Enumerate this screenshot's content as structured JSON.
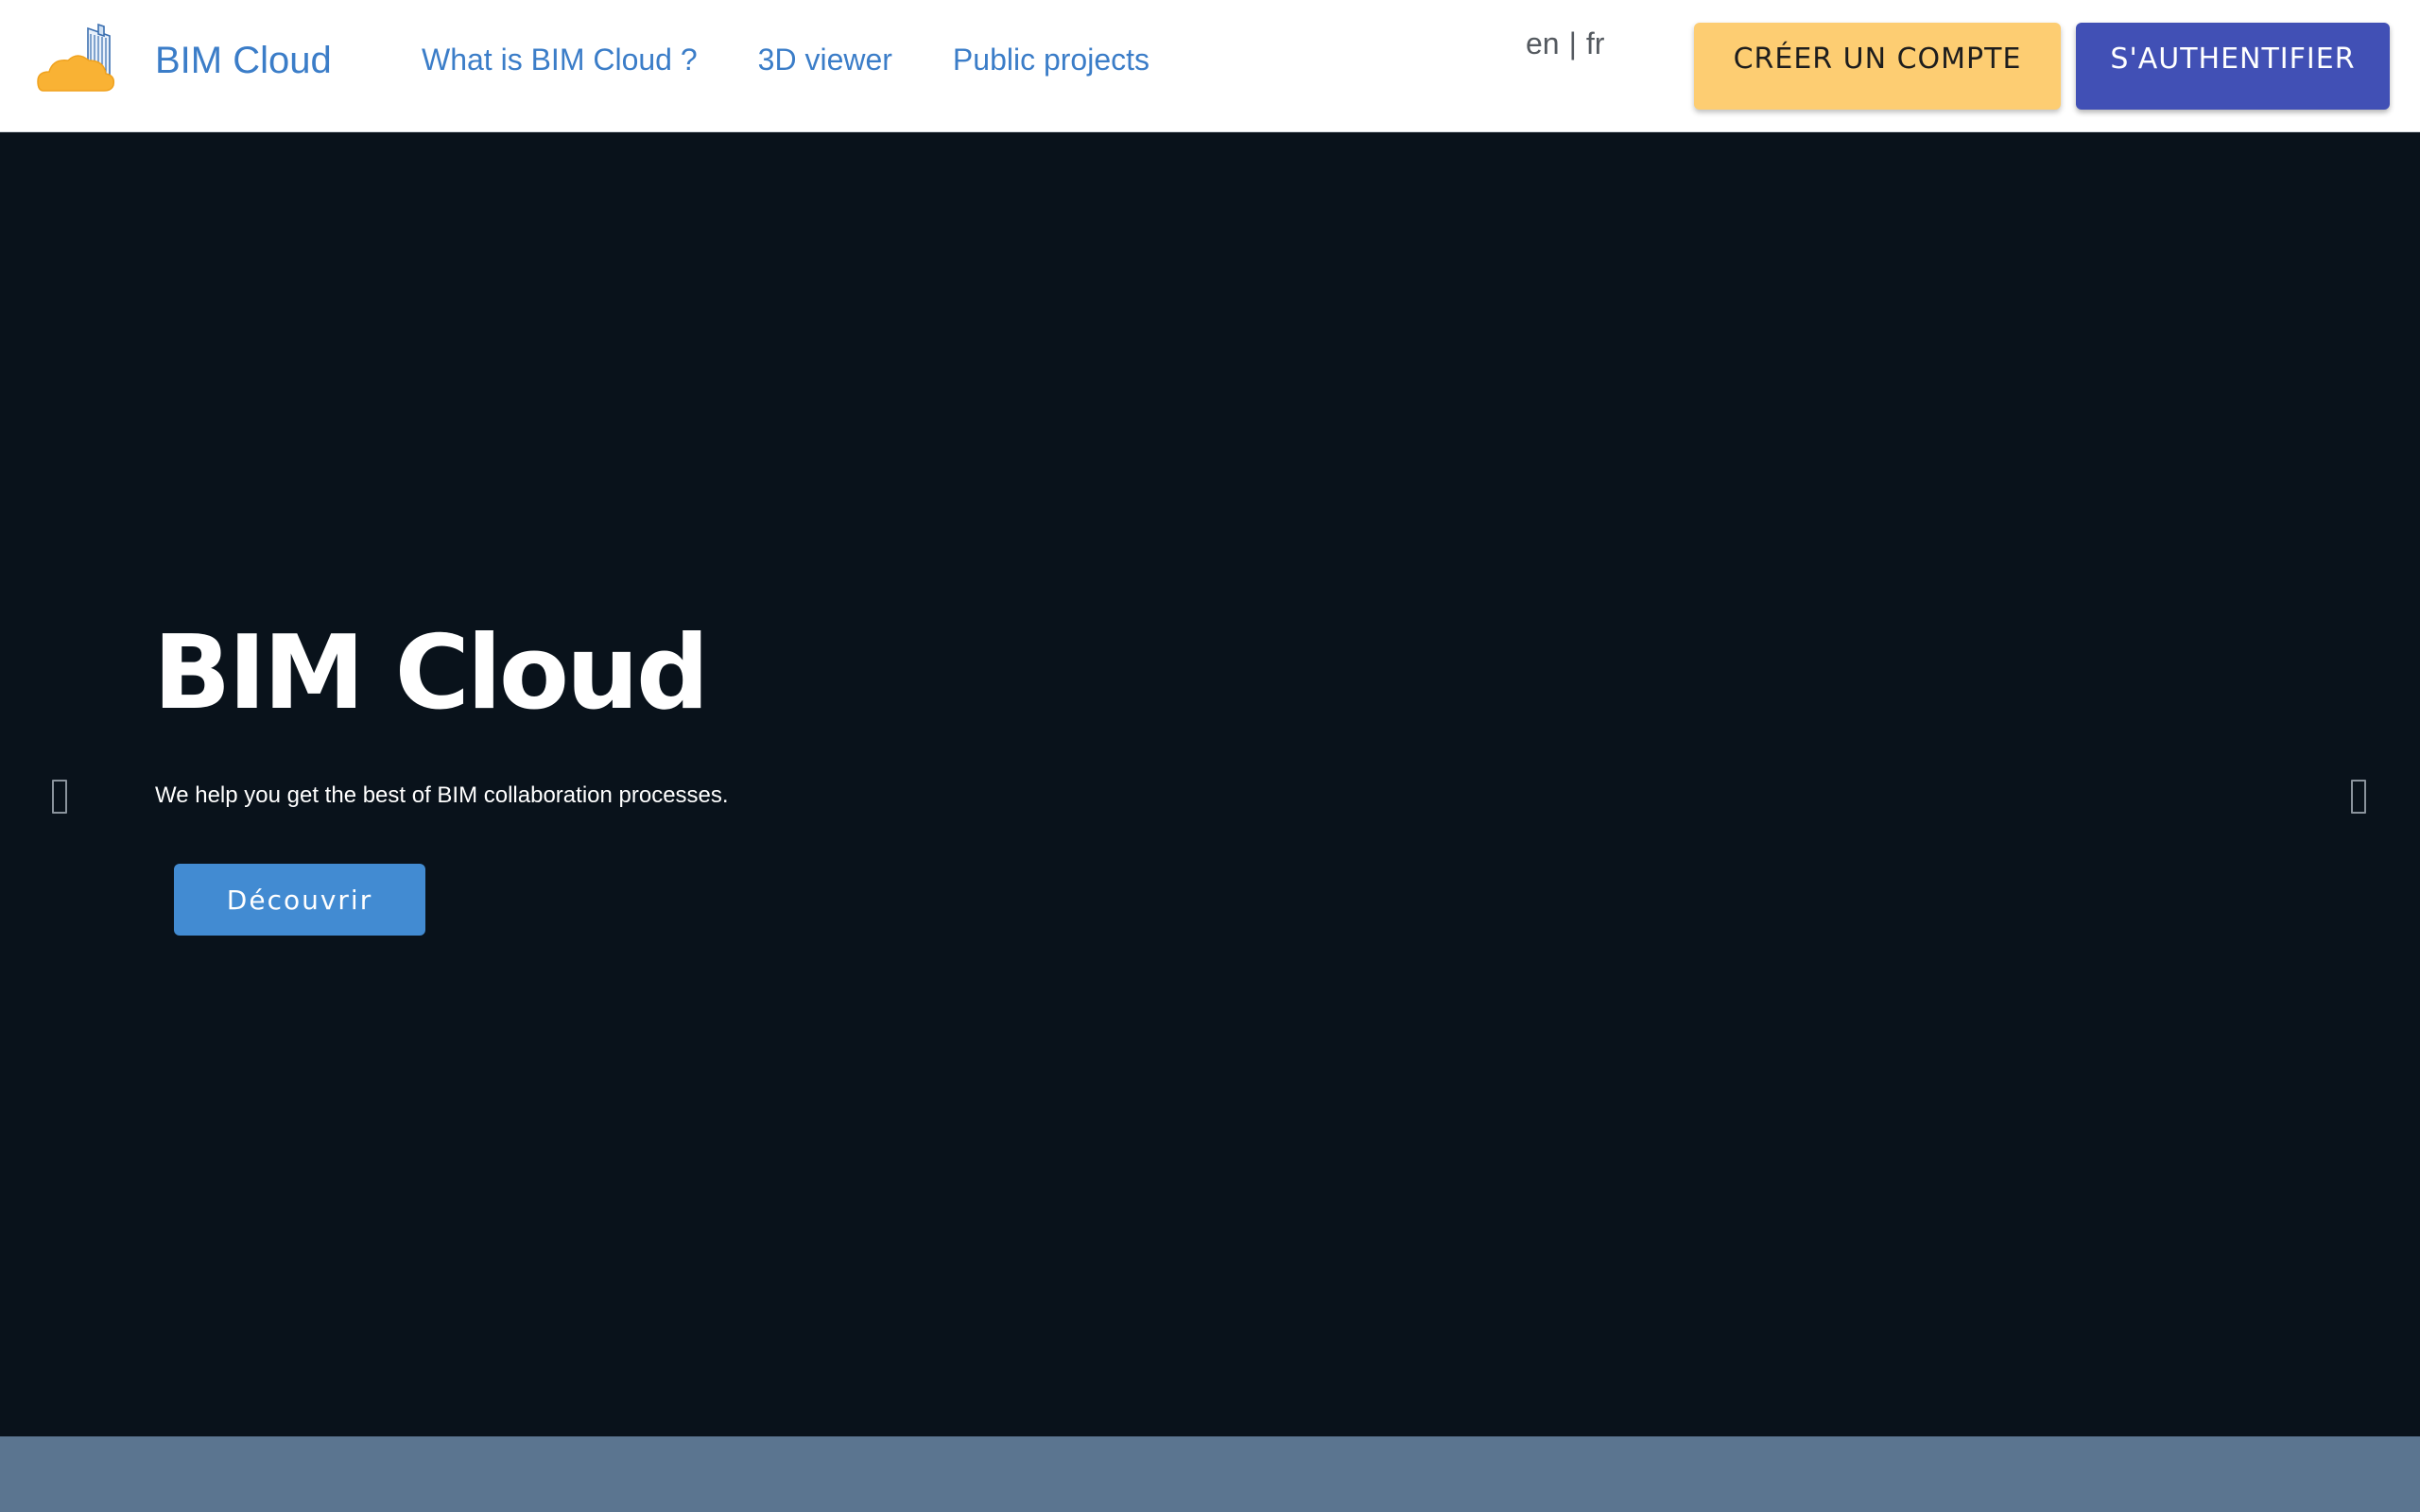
{
  "navbar": {
    "brand_name": "BIM Cloud",
    "logo_icon": "cloud-building-logo",
    "links": [
      {
        "label": "What is BIM Cloud ?"
      },
      {
        "label": "3D viewer"
      },
      {
        "label": "Public projects"
      }
    ],
    "lang": {
      "en": "en",
      "separator": "|",
      "fr": "fr"
    },
    "create_account_label": "CRÉER UN COMPTE",
    "login_label": "S'AUTHENTIFIER"
  },
  "hero": {
    "title": "BIM Cloud",
    "subtitle": "We help you get the best of BIM collaboration processes.",
    "cta_label": "Découvrir",
    "prev_icon": "carousel-prev-icon",
    "next_icon": "carousel-next-icon"
  },
  "colors": {
    "brand_blue": "#3b7dc8",
    "create_button": "#fdcd72",
    "login_button": "#4150b5",
    "hero_background": "#09121b",
    "cta_button": "#428bd2",
    "bottom_band": "#5b7590"
  }
}
